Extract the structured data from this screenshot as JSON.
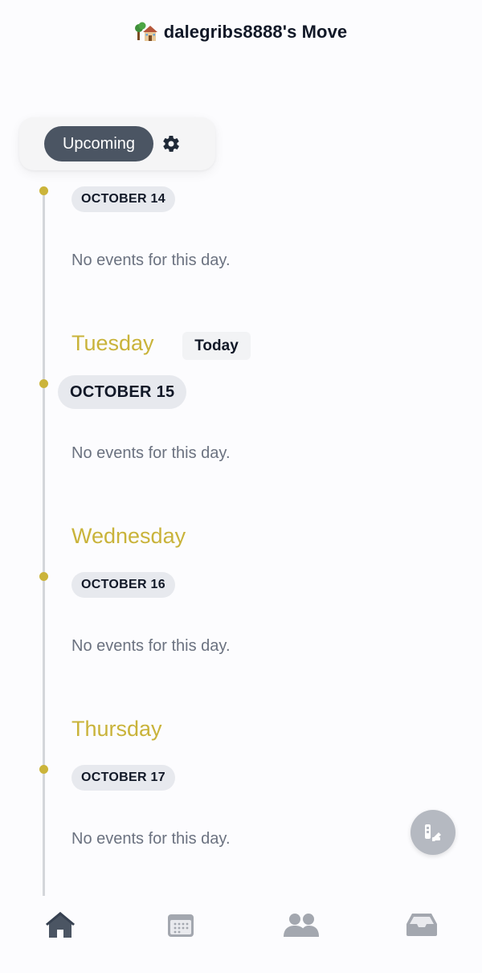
{
  "header": {
    "title": "dalegribs8888's Move",
    "icon": "house-with-tree-icon"
  },
  "filters": {
    "upcoming_label": "Upcoming",
    "settings_icon": "gear-icon"
  },
  "timeline": {
    "days": [
      {
        "day_name": "",
        "date_label": "OCTOBER 14",
        "empty_text": "No events for this day."
      },
      {
        "day_name": "Tuesday",
        "badge": "Today",
        "date_label": "OCTOBER 15",
        "empty_text": "No events for this day."
      },
      {
        "day_name": "Wednesday",
        "date_label": "OCTOBER 16",
        "empty_text": "No events for this day."
      },
      {
        "day_name": "Thursday",
        "date_label": "OCTOBER 17",
        "empty_text": "No events for this day."
      }
    ]
  },
  "fab": {
    "icon": "swatch-edit-icon"
  },
  "bottom_nav": {
    "items": [
      {
        "icon": "home-icon",
        "active": true
      },
      {
        "icon": "calendar-icon",
        "active": false
      },
      {
        "icon": "people-icon",
        "active": false
      },
      {
        "icon": "inbox-icon",
        "active": false
      }
    ]
  },
  "colors": {
    "accent_day": "#c9b33a",
    "timeline_dot": "#cbb43a",
    "pill_bg": "#e7e9ee",
    "upcoming_bg": "#4b5563",
    "nav_active": "#4b5563",
    "nav_inactive": "#a3a7af"
  }
}
